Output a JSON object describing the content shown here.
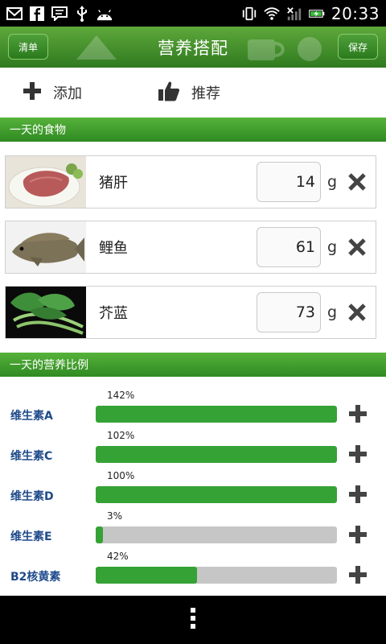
{
  "status_bar": {
    "time": "20:33"
  },
  "header": {
    "left_button": "清单",
    "title": "营养搭配",
    "right_button": "保存"
  },
  "actions": {
    "add_label": "添加",
    "recommend_label": "推荐"
  },
  "sections": {
    "foods_title": "一天的食物",
    "nutrition_title": "一天的营养比例"
  },
  "foods": [
    {
      "name": "猪肝",
      "quantity": "14",
      "unit": "g"
    },
    {
      "name": "鲤鱼",
      "quantity": "61",
      "unit": "g"
    },
    {
      "name": "芥蓝",
      "quantity": "73",
      "unit": "g"
    }
  ],
  "nutrients": [
    {
      "name": "维生素A",
      "percent_label": "142%",
      "fill_fraction": 1.0
    },
    {
      "name": "维生素C",
      "percent_label": "102%",
      "fill_fraction": 1.0
    },
    {
      "name": "维生素D",
      "percent_label": "100%",
      "fill_fraction": 1.0
    },
    {
      "name": "维生素E",
      "percent_label": "3%",
      "fill_fraction": 0.03
    },
    {
      "name": "B2核黄素",
      "percent_label": "42%",
      "fill_fraction": 0.42
    }
  ],
  "colors": {
    "header_green": "#3f8f2a",
    "section_green": "#3f9e2c",
    "bar_fill": "#35a235",
    "bar_track": "#c6c6c6",
    "nutrient_text": "#1e4a8a"
  }
}
